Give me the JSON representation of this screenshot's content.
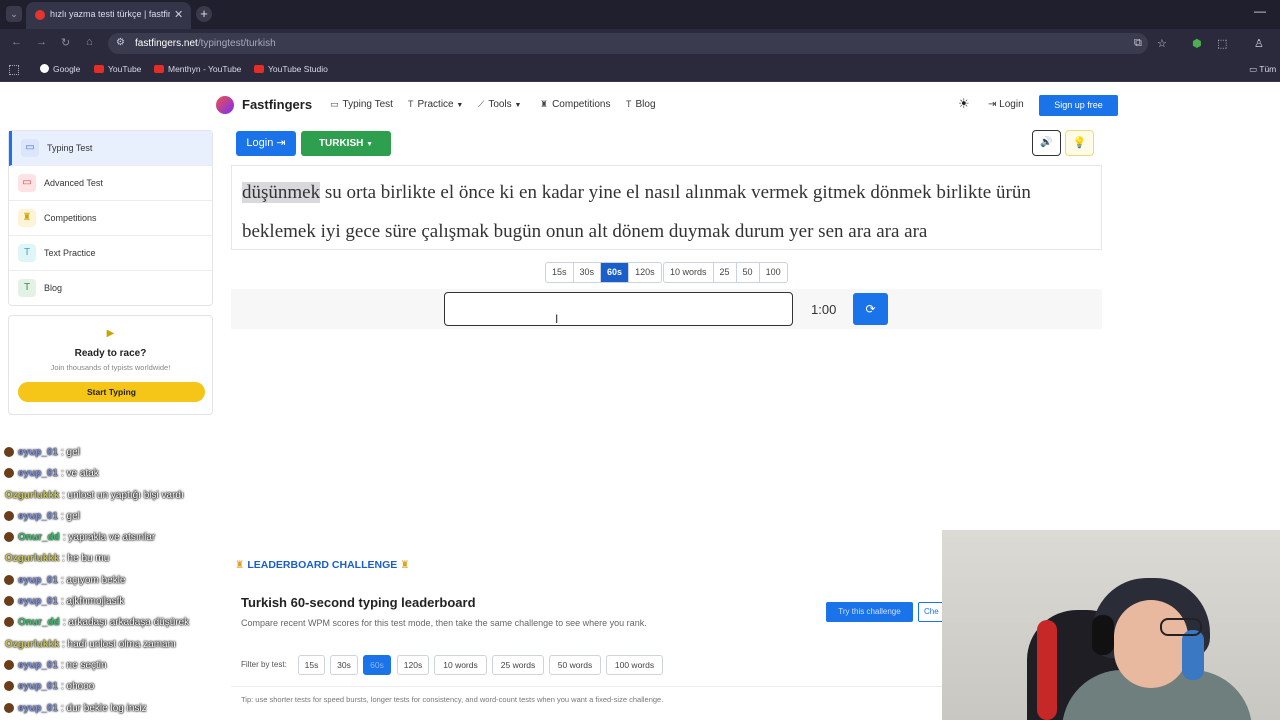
{
  "browser": {
    "tab_title": "hızlı yazma testi türkçe | fastfing",
    "url_domain": "fastfingers.net",
    "url_path": "/typingtest/turkish",
    "bookmarks": [
      {
        "label": "Google"
      },
      {
        "label": "YouTube"
      },
      {
        "label": "Menthyn - YouTube"
      },
      {
        "label": "YouTube Studio"
      },
      {
        "label": "Tüm"
      }
    ]
  },
  "header": {
    "logo": "Fastfingers",
    "nav": [
      {
        "label": "Typing Test",
        "icon": "keyboard-icon"
      },
      {
        "label": "Practice",
        "icon": "text-icon",
        "dropdown": true
      },
      {
        "label": "Tools",
        "icon": "chart-icon",
        "dropdown": true
      },
      {
        "label": "Competitions",
        "icon": "trophy-icon"
      },
      {
        "label": "Blog",
        "icon": "text-icon"
      }
    ],
    "login": "Login",
    "signup": "Sign up free"
  },
  "sidebar": {
    "items": [
      {
        "label": "Typing Test",
        "active": true
      },
      {
        "label": "Advanced Test"
      },
      {
        "label": "Competitions"
      },
      {
        "label": "Text Practice"
      },
      {
        "label": "Blog"
      }
    ],
    "race": {
      "title": "Ready to race?",
      "subtitle": "Join thousands of typists worldwide!",
      "button": "Start Typing"
    }
  },
  "test": {
    "login_button": "Login",
    "language_button": "TURKISH",
    "current_word": "düşünmek",
    "words_rest": " su orta birlikte el önce ki en kadar yine el nasıl alınmak vermek gitmek dönmek birlikte ürün beklemek iyi gece süre çalışmak bugün onun alt dönem duymak durum yer sen ara ara ara",
    "time_modes": [
      "15s",
      "30s",
      "60s",
      "120s"
    ],
    "active_mode": "60s",
    "word_modes": [
      "10 words",
      "25",
      "50",
      "100"
    ],
    "timer": "1:00"
  },
  "leaderboard": {
    "heading": "LEADERBOARD CHALLENGE",
    "title": "Turkish 60-second typing leaderboard",
    "subtitle": "Compare recent WPM scores for this test mode, then take the same challenge to see where you rank.",
    "try_button": "Try this challenge",
    "secondary_button": "Che",
    "filter_label": "Filter by test:",
    "filters": [
      "15s",
      "30s",
      "60s",
      "120s",
      "10 words",
      "25 words",
      "50 words",
      "100 words"
    ],
    "active_filter": "60s",
    "tip": "Tip: use shorter tests for speed bursts, longer tests for consistency, and word-count tests when you want a fixed-size challenge."
  },
  "chat": [
    {
      "user": "eyup_01",
      "msg": ": gel",
      "color": "#7d8fd6",
      "avatar": true
    },
    {
      "user": "eyup_01",
      "msg": ": ve atak",
      "color": "#7d8fd6",
      "avatar": true
    },
    {
      "user": "Ozgurlukkk",
      "msg": ": unlost un yaptığı bişi vardı",
      "color": "#c9c75a",
      "avatar": false
    },
    {
      "user": "eyup_01",
      "msg": ": gel",
      "color": "#7d8fd6",
      "avatar": true
    },
    {
      "user": "Onur_dd",
      "msg": ": yaprakla ve atsınlar",
      "color": "#3fbf6f",
      "avatar": true
    },
    {
      "user": "Ozgurlukkk",
      "msg": ": he bu mu",
      "color": "#c9c75a",
      "avatar": false
    },
    {
      "user": "eyup_01",
      "msg": ": açıyom bekle",
      "color": "#7d8fd6",
      "avatar": true
    },
    {
      "user": "eyup_01",
      "msg": ": ajkfnmojlasfk",
      "color": "#7d8fd6",
      "avatar": true
    },
    {
      "user": "Onur_dd",
      "msg": ": arkadaşı arkadaşa düşürek",
      "color": "#3fbf6f",
      "avatar": true
    },
    {
      "user": "Ozgurlukkk",
      "msg": ": hadi unlost olma zamanı",
      "color": "#c9c75a",
      "avatar": false
    },
    {
      "user": "eyup_01",
      "msg": ": ne seçtin",
      "color": "#7d8fd6",
      "avatar": true
    },
    {
      "user": "eyup_01",
      "msg": ": ohooo",
      "color": "#7d8fd6",
      "avatar": true
    },
    {
      "user": "eyup_01",
      "msg": ": dur bekle log insiz",
      "color": "#7d8fd6",
      "avatar": true
    }
  ],
  "colors": {
    "primary": "#1a73e8",
    "lang_green": "#2e9e4f",
    "race_yellow": "#f5c518"
  }
}
